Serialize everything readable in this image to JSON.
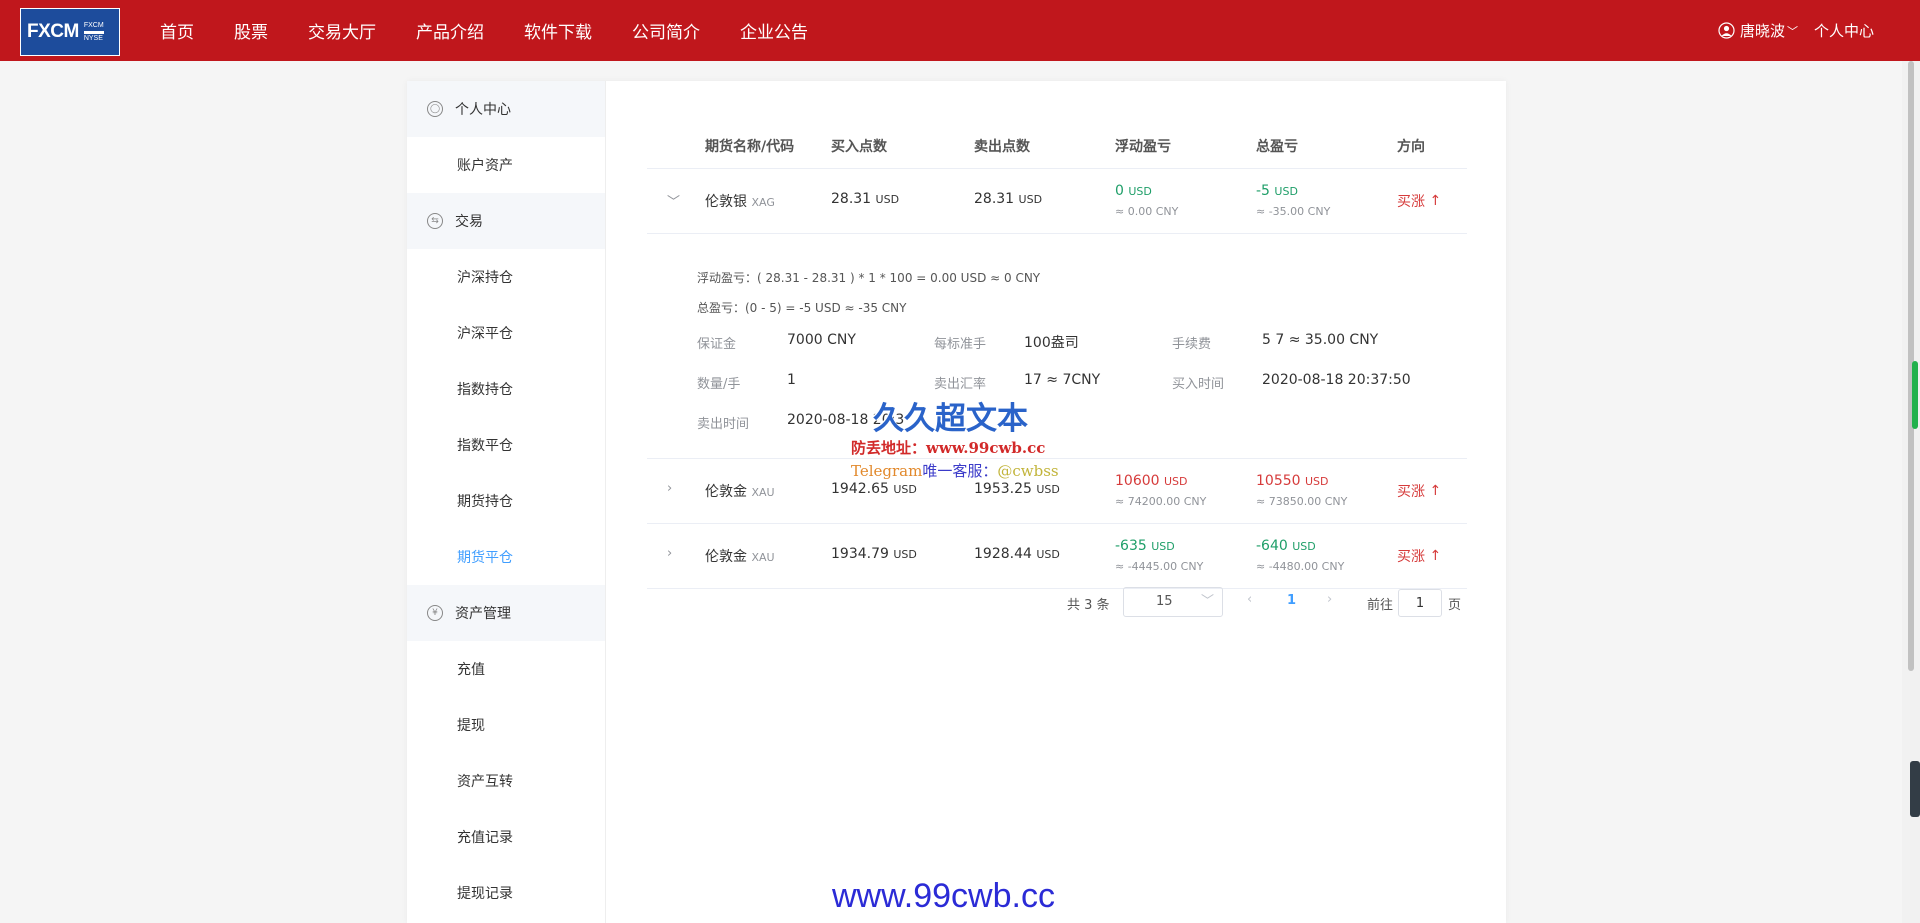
{
  "header": {
    "logo": "FXCM",
    "logo_sub": [
      "FXCM",
      "NYSE"
    ],
    "nav": [
      "首页",
      "股票",
      "交易大厅",
      "产品介绍",
      "软件下载",
      "公司简介",
      "企业公告"
    ],
    "user_name": "唐晓波",
    "user_center": "个人中心",
    "colors": {
      "header_bg": "#c0171c",
      "accent": "#409eff"
    }
  },
  "sidebar": {
    "group_personal": "个人中心",
    "account_assets": "账户资产",
    "group_trade": "交易",
    "trade_items": [
      "沪深持仓",
      "沪深平仓",
      "指数持仓",
      "指数平仓",
      "期货持仓",
      "期货平仓"
    ],
    "active_item": "期货平仓",
    "group_assets": "资产管理",
    "asset_items": [
      "充值",
      "提现",
      "资产互转",
      "充值记录",
      "提现记录"
    ],
    "icons": {
      "personal": "user-circle-icon",
      "trade": "exchange-icon",
      "assets": "yen-icon"
    }
  },
  "table": {
    "headers": [
      "期货名称/代码",
      "买入点数",
      "卖出点数",
      "浮动盈亏",
      "总盈亏",
      "方向"
    ],
    "rows": [
      {
        "name": "伦敦银",
        "code": "XAG",
        "buy": "28.31",
        "sell": "28.31",
        "unit": "USD",
        "float_pl": "0",
        "float_pl_cny": "≈ 0.00 CNY",
        "total_pl": "-5",
        "total_pl_cny": "≈ -35.00 CNY",
        "direction": "买涨",
        "expanded": true
      },
      {
        "name": "伦敦金",
        "code": "XAU",
        "buy": "1942.65",
        "sell": "1953.25",
        "unit": "USD",
        "float_pl": "10600",
        "float_pl_cny": "≈ 74200.00 CNY",
        "total_pl": "10550",
        "total_pl_cny": "≈ 73850.00 CNY",
        "direction": "买涨",
        "expanded": false
      },
      {
        "name": "伦敦金",
        "code": "XAU",
        "buy": "1934.79",
        "sell": "1928.44",
        "unit": "USD",
        "float_pl": "-635",
        "float_pl_cny": "≈ -4445.00 CNY",
        "total_pl": "-640",
        "total_pl_cny": "≈ -4480.00 CNY",
        "direction": "买涨",
        "expanded": false
      }
    ],
    "detail": {
      "float_formula": "浮动盈亏：( 28.31 - 28.31 ) * 1 * 100 = 0.00 USD ≈ 0 CNY",
      "total_formula": "总盈亏：(0 - 5) = -5 USD ≈ -35 CNY",
      "margin_label": "保证金",
      "margin_value": "7000 CNY",
      "std_lot_label": "每标准手",
      "std_lot_value": "100盎司",
      "fee_label": "手续费",
      "fee_value": "5 7 ≈ 35.00 CNY",
      "qty_label": "数量/手",
      "qty_value": "1",
      "sell_rate_label": "卖出汇率",
      "sell_rate_value": "17 ≈ 7CNY",
      "buy_time_label": "买入时间",
      "buy_time_value": "2020-08-18 20:37:50",
      "sell_time_label": "卖出时间",
      "sell_time_value": "2020-08-18 20:3"
    }
  },
  "pagination": {
    "total": "共 3 条",
    "page_size": "15",
    "current": "1",
    "goto_label": "前往",
    "goto_value": "1",
    "page_label": "页"
  },
  "watermark": {
    "title": "久久超文本",
    "url_line": "防丢地址：www.99cwb.cc",
    "tg_a": "Telegram",
    "tg_b": "唯一客服：",
    "tg_c": "@cwbss",
    "footer_url": "www.99cwb.cc"
  }
}
